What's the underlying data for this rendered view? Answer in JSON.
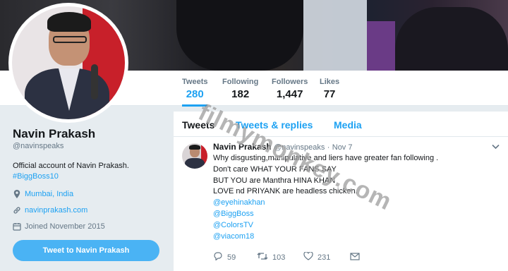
{
  "profile": {
    "name": "Navin Prakash",
    "handle": "@navinspeaks",
    "bio_line1": "Official account of Navin Prakash.",
    "bio_hashtag": "#BiggBoss10",
    "location": "Mumbai, India",
    "website": "navinprakash.com",
    "joined": "Joined November 2015",
    "tweet_to_button": "Tweet to Navin Prakash"
  },
  "stats": [
    {
      "label": "Tweets",
      "value": "280",
      "active": true
    },
    {
      "label": "Following",
      "value": "182",
      "active": false
    },
    {
      "label": "Followers",
      "value": "1,447",
      "active": false
    },
    {
      "label": "Likes",
      "value": "77",
      "active": false
    }
  ],
  "timeline_tabs": [
    {
      "label": "Tweets",
      "active": true
    },
    {
      "label": "Tweets & replies",
      "active": false
    },
    {
      "label": "Media",
      "active": false
    }
  ],
  "tweet": {
    "name": "Navin Prakash",
    "handle": "@navinspeaks",
    "dot": "·",
    "time": "Nov 7",
    "lines": [
      "Why disgusting,manipulative and liers have greater fan following .",
      "Don't care WHAT YOUR FANS SAY",
      "BUT YOU are Manthra HINA KHAN",
      "LOVE nd PRIYANK are headless chicken."
    ],
    "mentions": [
      "@eyehinakhan",
      "@BiggBoss",
      "@ColorsTV",
      "@viacom18"
    ],
    "replies": "59",
    "retweets": "103",
    "likes": "231"
  },
  "watermark": "filmymonkey.com",
  "icons": {
    "location": "location-pin-icon",
    "link": "link-icon",
    "calendar": "calendar-icon",
    "chevron": "chevron-down-icon",
    "reply": "reply-icon",
    "retweet": "retweet-icon",
    "like": "heart-icon",
    "dm": "envelope-icon"
  },
  "colors": {
    "accent": "#1da1f2",
    "button": "#4ab3f4",
    "muted": "#657786",
    "bg": "#e6ecf0"
  }
}
